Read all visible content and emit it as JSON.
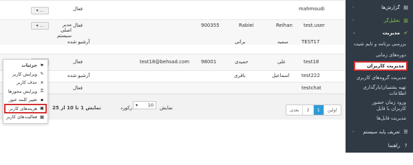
{
  "sidebar": {
    "items": [
      {
        "label": "گزارش‌ها",
        "icon": "file-icon"
      },
      {
        "label": "تحلیل‌گر",
        "icon": "chart-icon"
      },
      {
        "label": "مدیریت",
        "icon": "gear-icon"
      }
    ],
    "subitems": [
      "بررسی برنامه و تایم شیت",
      "دوره‌های زمانی",
      "مدیریت کاربران",
      "مدیریت گروه‌های کاربری",
      "تهیه پشتیبان/بارگذاری اطلاعات",
      "ورود زمان حضور کاربران با فایل",
      "مدیریت فایل‌ها"
    ],
    "bottom": [
      {
        "label": "تعریف پایه سیستم",
        "icon": "settings-icon"
      },
      {
        "label": "راهنما",
        "icon": "help-icon"
      }
    ]
  },
  "table": {
    "rows": [
      {
        "username": "mahmoudi",
        "first": "",
        "last": "",
        "code": "",
        "email": "",
        "status": "فعال",
        "role": ""
      },
      {
        "username": "test.user",
        "first": "Reihan",
        "last": "Rabiei",
        "code": "900355",
        "email": "",
        "status": "فعال",
        "role": "مدیر اصلی سیستم"
      },
      {
        "username": "TEST17",
        "first": "سمیه",
        "last": "براتی",
        "code": "",
        "email": "",
        "status": "آرشیو شده",
        "role": ""
      },
      {
        "username": "test18",
        "first": "علی",
        "last": "حمیدی",
        "code": "98001",
        "email": "test18@behsad.com",
        "status": "فعال",
        "role": ""
      },
      {
        "username": "test222",
        "first": "اسماعیل",
        "last": "باقری",
        "code": "",
        "email": "",
        "status": "آرشیو شده",
        "role": ""
      },
      {
        "username": "testchat",
        "first": "",
        "last": "",
        "code": "",
        "email": "",
        "status": "فعال",
        "role": ""
      }
    ],
    "action_button": "..."
  },
  "menu": {
    "items": [
      {
        "label": "جزئیات",
        "icon": "flag-icon"
      },
      {
        "label": "ویرایش کاربر",
        "icon": "edit-icon"
      },
      {
        "label": "حذف کاربر",
        "icon": "x-icon"
      },
      {
        "label": "ویرایش مجوزها",
        "icon": "key-icon"
      },
      {
        "label": "تغییر کلمه عبور",
        "icon": "lock-icon"
      },
      {
        "label": "هزینه‌های کاربر",
        "icon": "money-icon"
      },
      {
        "label": "فعالیت‌های کاربر",
        "icon": "grid-icon"
      }
    ]
  },
  "footer": {
    "summary": "نمایش 1 تا 10 از 25",
    "show_label": "نمایش",
    "per_page": "10",
    "records_label": "رکورد",
    "pager": [
      "اولین",
      "1",
      "2",
      "بعدی"
    ]
  }
}
